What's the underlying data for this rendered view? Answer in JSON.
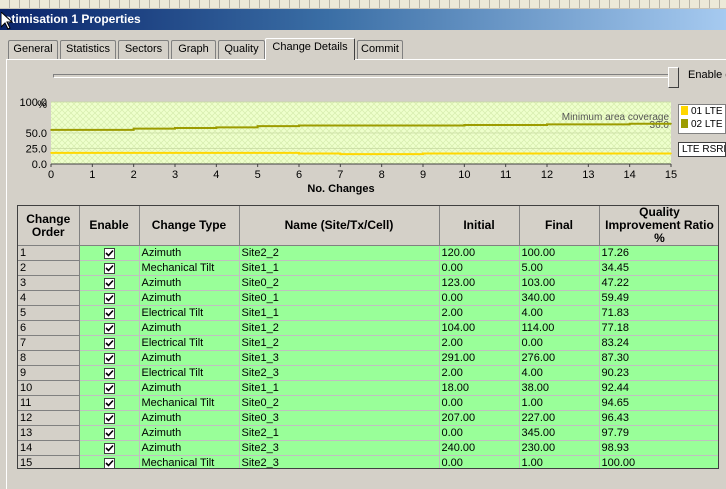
{
  "window": {
    "title": "otimisation 1 Properties"
  },
  "tabs": [
    {
      "label": "General"
    },
    {
      "label": "Statistics"
    },
    {
      "label": "Sectors"
    },
    {
      "label": "Graph"
    },
    {
      "label": "Quality"
    },
    {
      "label": "Change Details",
      "active": true
    },
    {
      "label": "Commit"
    }
  ],
  "slider": {
    "enable_label": "Enable c"
  },
  "legend": {
    "items": [
      {
        "label": "01 LTE",
        "color": "#ffd700"
      },
      {
        "label": "02 LTE",
        "color": "#9c9c00"
      }
    ],
    "box_label": "LTE RSRF"
  },
  "chart_data": {
    "type": "line",
    "ylabel": "%",
    "xlabel": "No. Changes",
    "xlim": [
      0,
      15
    ],
    "ylim": [
      0,
      100
    ],
    "x_ticks": [
      "0",
      "1",
      "2",
      "3",
      "4",
      "5",
      "6",
      "7",
      "8",
      "9",
      "10",
      "11",
      "12",
      "13",
      "14",
      "15"
    ],
    "y_ticks": [
      "100.0",
      "50.0",
      "25.0",
      "0.0"
    ],
    "annotation": "Minimum area coverage",
    "annotation_value": "36.0",
    "series": [
      {
        "name": "01 LTE",
        "color": "#ffd700",
        "x": [
          0,
          1,
          2,
          3,
          4,
          5,
          6,
          7,
          8,
          9,
          10,
          11,
          12,
          13,
          14,
          15
        ],
        "y": [
          18,
          18,
          18,
          18,
          18,
          18,
          17,
          16,
          16,
          17,
          17,
          17,
          17,
          17,
          17,
          17
        ]
      },
      {
        "name": "02 LTE",
        "color": "#9c9c00",
        "x": [
          0,
          1,
          2,
          3,
          4,
          5,
          6,
          7,
          8,
          9,
          10,
          11,
          12,
          13,
          14,
          15
        ],
        "y": [
          55,
          55,
          57,
          58,
          59,
          61,
          62,
          62,
          62,
          62,
          63,
          63,
          64,
          64,
          65,
          65
        ]
      }
    ]
  },
  "table": {
    "headers": [
      "Change Order",
      "Enable",
      "Change Type",
      "Name (Site/Tx/Cell)",
      "Initial",
      "Final",
      "Quality Improvement Ratio %"
    ],
    "rows": [
      {
        "order": "1",
        "enabled": true,
        "type": "Azimuth",
        "name": "Site2_2",
        "initial": "120.00",
        "final": "100.00",
        "ratio": "17.26"
      },
      {
        "order": "2",
        "enabled": true,
        "type": "Mechanical Tilt",
        "name": "Site1_1",
        "initial": "0.00",
        "final": "5.00",
        "ratio": "34.45"
      },
      {
        "order": "3",
        "enabled": true,
        "type": "Azimuth",
        "name": "Site0_2",
        "initial": "123.00",
        "final": "103.00",
        "ratio": "47.22"
      },
      {
        "order": "4",
        "enabled": true,
        "type": "Azimuth",
        "name": "Site0_1",
        "initial": "0.00",
        "final": "340.00",
        "ratio": "59.49"
      },
      {
        "order": "5",
        "enabled": true,
        "type": "Electrical Tilt",
        "name": "Site1_1",
        "initial": "2.00",
        "final": "4.00",
        "ratio": "71.83"
      },
      {
        "order": "6",
        "enabled": true,
        "type": "Azimuth",
        "name": "Site1_2",
        "initial": "104.00",
        "final": "114.00",
        "ratio": "77.18"
      },
      {
        "order": "7",
        "enabled": true,
        "type": "Electrical Tilt",
        "name": "Site1_2",
        "initial": "2.00",
        "final": "0.00",
        "ratio": "83.24"
      },
      {
        "order": "8",
        "enabled": true,
        "type": "Azimuth",
        "name": "Site1_3",
        "initial": "291.00",
        "final": "276.00",
        "ratio": "87.30"
      },
      {
        "order": "9",
        "enabled": true,
        "type": "Electrical Tilt",
        "name": "Site2_3",
        "initial": "2.00",
        "final": "4.00",
        "ratio": "90.23"
      },
      {
        "order": "10",
        "enabled": true,
        "type": "Azimuth",
        "name": "Site1_1",
        "initial": "18.00",
        "final": "38.00",
        "ratio": "92.44"
      },
      {
        "order": "11",
        "enabled": true,
        "type": "Mechanical Tilt",
        "name": "Site0_2",
        "initial": "0.00",
        "final": "1.00",
        "ratio": "94.65"
      },
      {
        "order": "12",
        "enabled": true,
        "type": "Azimuth",
        "name": "Site0_3",
        "initial": "207.00",
        "final": "227.00",
        "ratio": "96.43"
      },
      {
        "order": "13",
        "enabled": true,
        "type": "Azimuth",
        "name": "Site2_1",
        "initial": "0.00",
        "final": "345.00",
        "ratio": "97.79"
      },
      {
        "order": "14",
        "enabled": true,
        "type": "Azimuth",
        "name": "Site2_3",
        "initial": "240.00",
        "final": "230.00",
        "ratio": "98.93"
      },
      {
        "order": "15",
        "enabled": true,
        "type": "Mechanical Tilt",
        "name": "Site2_3",
        "initial": "0.00",
        "final": "1.00",
        "ratio": "100.00"
      }
    ]
  },
  "colors": {
    "row_green": "#99ff99",
    "chart_bg": "#eeffcc",
    "title_start": "#0a246a",
    "title_end": "#a6caf0"
  }
}
